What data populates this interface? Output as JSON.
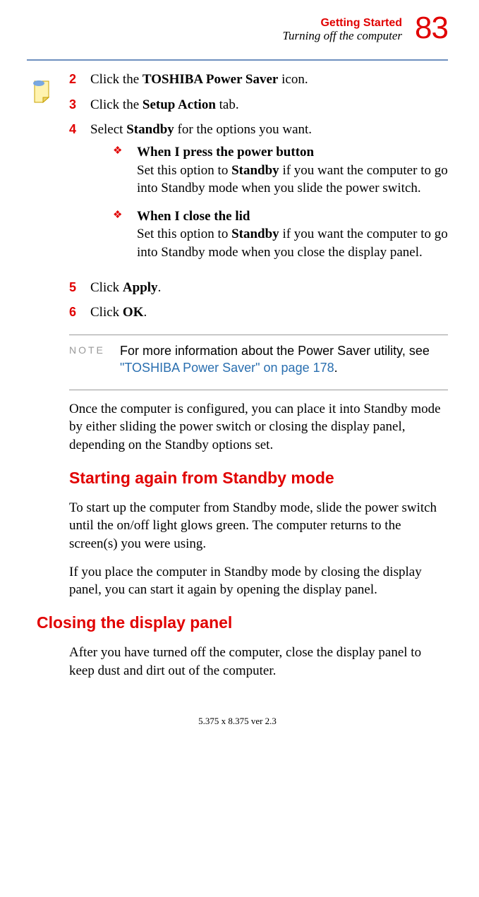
{
  "header": {
    "chapter": "Getting Started",
    "section": "Turning off the computer",
    "pagenum": "83"
  },
  "steps": {
    "s2_num": "2",
    "s2_a": "Click the ",
    "s2_b": "TOSHIBA Power Saver",
    "s2_c": " icon.",
    "s3_num": "3",
    "s3_a": "Click the ",
    "s3_b": "Setup Action",
    "s3_c": " tab.",
    "s4_num": "4",
    "s4_a": "Select ",
    "s4_b": "Standby",
    "s4_c": " for the options you want.",
    "sub1_title": "When I press the power button",
    "sub1_a": "Set this option to ",
    "sub1_b": "Standby",
    "sub1_c": " if you want the computer to go into Standby mode when you slide the power switch.",
    "sub2_title": "When I close the lid",
    "sub2_a": "Set this option to ",
    "sub2_b": "Standby",
    "sub2_c": " if you want the computer to go into Standby mode when you close the display panel.",
    "s5_num": "5",
    "s5_a": "Click ",
    "s5_b": "Apply",
    "s5_c": ".",
    "s6_num": "6",
    "s6_a": "Click ",
    "s6_b": "OK",
    "s6_c": "."
  },
  "note": {
    "label": "NOTE",
    "text": "For more information about the Power Saver utility, see ",
    "link": "\"TOSHIBA Power Saver\" on page 178",
    "tail": "."
  },
  "para1": "Once the computer is configured, you can place it into Standby mode by either sliding the power switch or closing the display panel, depending on the Standby options set.",
  "heading1": "Starting again from Standby mode",
  "para2": "To start up the computer from Standby mode, slide the power switch until the on/off light glows green. The computer returns to the screen(s) you were using.",
  "para3": "If you place the computer in Standby mode by closing the display panel, you can start it again by opening the display panel.",
  "heading2": "Closing the display panel",
  "para4": "After you have turned off the computer, close the display panel to keep dust and dirt out of the computer.",
  "footer": "5.375 x 8.375 ver 2.3"
}
